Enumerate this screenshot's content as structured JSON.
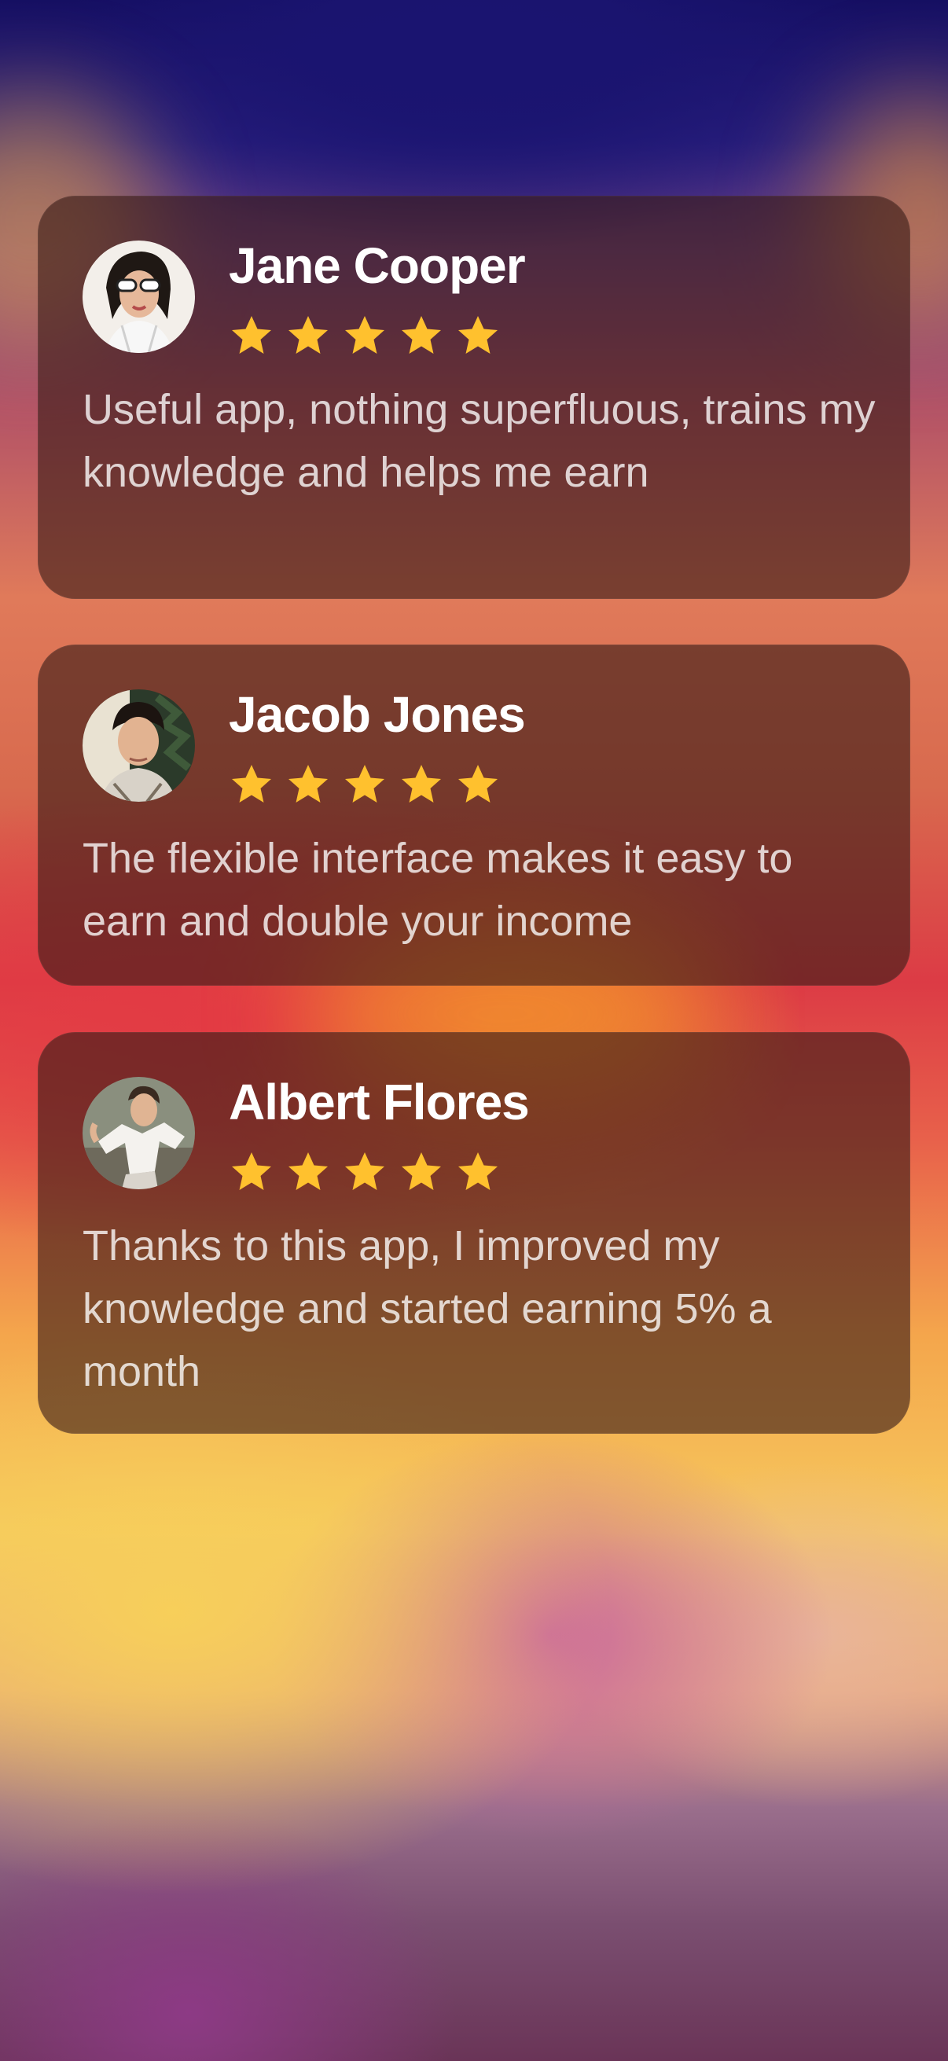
{
  "reviews": [
    {
      "name": "Jane Cooper",
      "rating": 5,
      "text": "Useful app, nothing superfluous, trains my knowledge and helps me earn",
      "avatar_icon": "person-photo-icon"
    },
    {
      "name": "Jacob Jones",
      "rating": 5,
      "text": "The flexible interface makes it easy to earn and double your income",
      "avatar_icon": "person-photo-icon"
    },
    {
      "name": "Albert Flores",
      "rating": 5,
      "text": "Thanks to this app, I improved my knowledge and started earning 5% a month",
      "avatar_icon": "person-photo-icon"
    }
  ],
  "colors": {
    "star": "#FFC12E",
    "card_background": "rgba(58,28,22,0.62)",
    "name_text": "#FFFFFF",
    "review_text": "rgba(255,255,255,0.78)"
  }
}
